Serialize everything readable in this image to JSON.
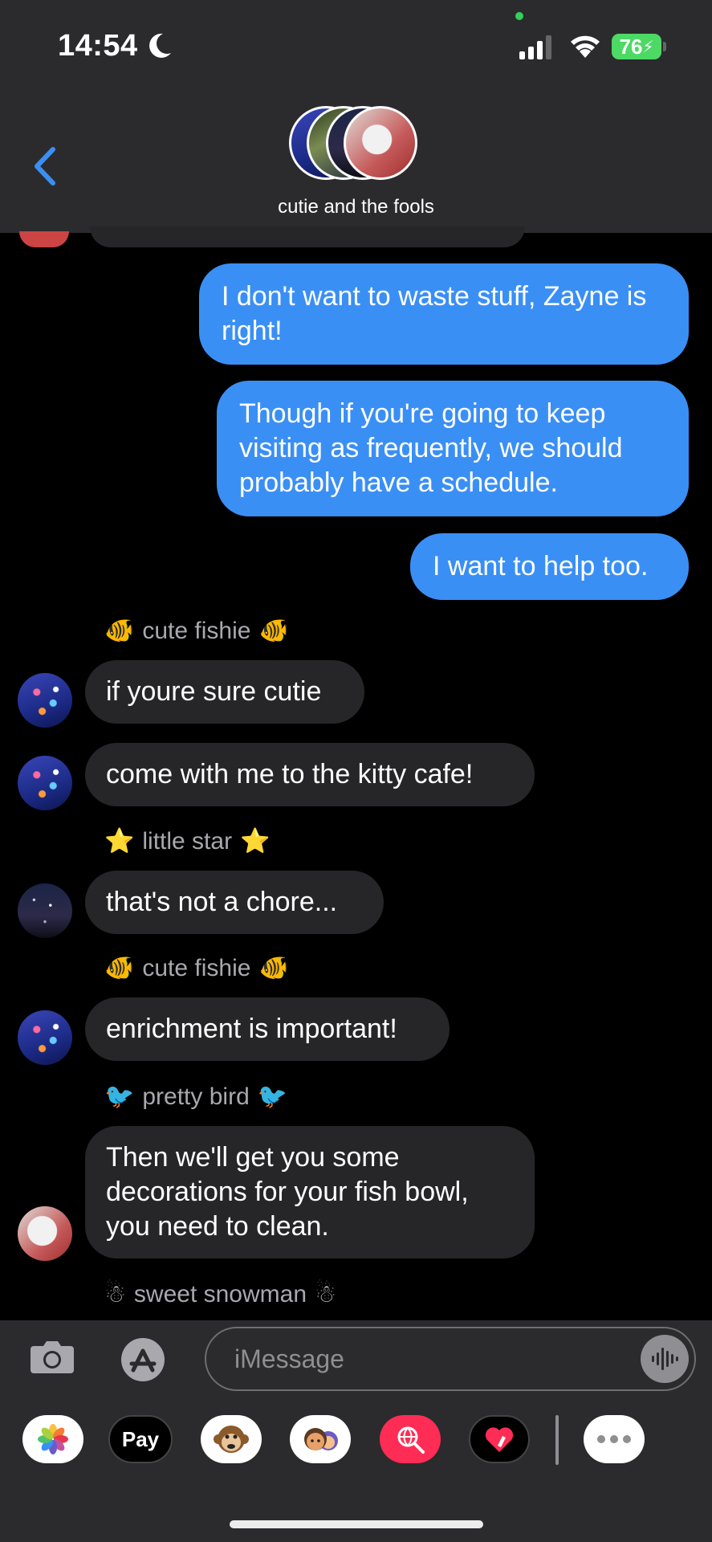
{
  "status_bar": {
    "time": "14:54",
    "battery": "76"
  },
  "header": {
    "group_name": "cutie and the fools"
  },
  "messages": [
    {
      "type": "outgoing",
      "text": "I don't want to waste stuff, Zayne is right!"
    },
    {
      "type": "outgoing",
      "text": "Though if you're going to keep visiting as frequently, we should probably have a schedule."
    },
    {
      "type": "outgoing",
      "text": "I want to help too."
    },
    {
      "type": "sender",
      "name": "cute fishie",
      "emoji": "🐠"
    },
    {
      "type": "incoming",
      "text": "if youre sure cutie",
      "avatar": "fish"
    },
    {
      "type": "incoming",
      "text": "come with me to the kitty cafe!",
      "avatar": "fish"
    },
    {
      "type": "sender",
      "name": "little star",
      "emoji": "⭐"
    },
    {
      "type": "incoming",
      "text": "that's not a chore...",
      "avatar": "star"
    },
    {
      "type": "sender",
      "name": "cute fishie",
      "emoji": "🐠"
    },
    {
      "type": "incoming",
      "text": "enrichment is important!",
      "avatar": "fish"
    },
    {
      "type": "sender",
      "name": "pretty bird",
      "emoji": "🐦"
    },
    {
      "type": "incoming",
      "text": "Then we'll get you some decorations for your fish bowl, you need to clean.",
      "avatar": "cat"
    },
    {
      "type": "sender",
      "name": "sweet snowman",
      "emoji": "☃"
    }
  ],
  "input": {
    "placeholder": "iMessage"
  },
  "drawer": {
    "apple_pay_label": "Pay"
  },
  "colors": {
    "outgoing_bubble": "#3a8ff5",
    "incoming_bubble": "#262628",
    "bar_background": "#2b2b2d",
    "accent": "#3a8ff5"
  }
}
